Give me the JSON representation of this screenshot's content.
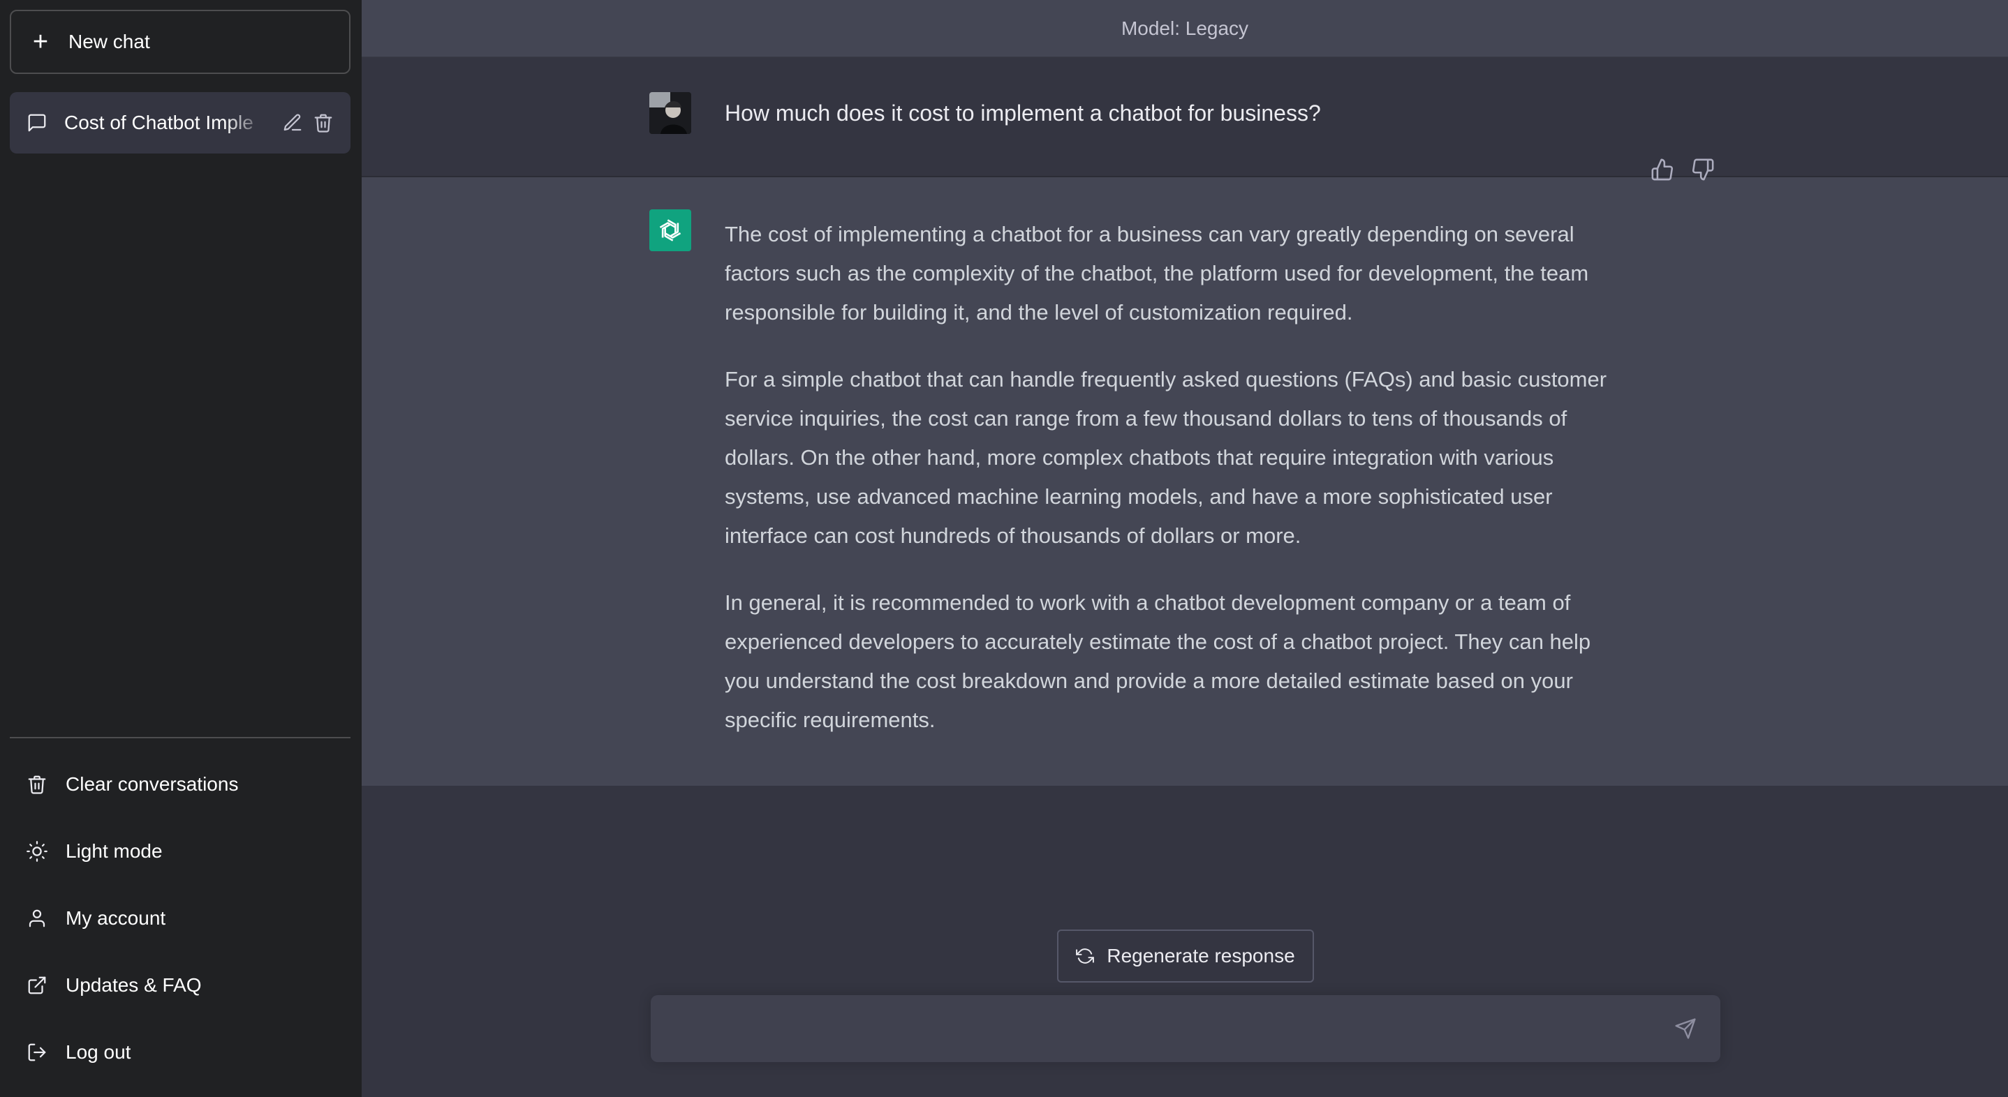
{
  "sidebar": {
    "new_chat_label": "New chat",
    "conversations": [
      {
        "title": "Cost of Chatbot Imple"
      }
    ],
    "menu": {
      "clear_label": "Clear conversations",
      "light_mode_label": "Light mode",
      "account_label": "My account",
      "updates_label": "Updates & FAQ",
      "logout_label": "Log out"
    }
  },
  "header": {
    "model_label": "Model: Legacy"
  },
  "messages": {
    "user_question": "How much does it cost to implement a chatbot for business?",
    "assistant_paragraphs": [
      "The cost of implementing a chatbot for a business can vary greatly depending on several factors such as the complexity of the chatbot, the platform used for development, the team responsible for building it, and the level of customization required.",
      "For a simple chatbot that can handle frequently asked questions (FAQs) and basic customer service inquiries, the cost can range from a few thousand dollars to tens of thousands of dollars. On the other hand, more complex chatbots that require integration with various systems, use advanced machine learning models, and have a more sophisticated user interface can cost hundreds of thousands of dollars or more.",
      "In general, it is recommended to work with a chatbot development company or a team of experienced developers to accurately estimate the cost of a chatbot project. They can help you understand the cost breakdown and provide a more detailed estimate based on your specific requirements."
    ]
  },
  "composer": {
    "regenerate_label": "Regenerate response",
    "input_value": "",
    "input_placeholder": ""
  },
  "colors": {
    "sidebar_bg": "#202123",
    "main_bg": "#343541",
    "assistant_bg": "#444654",
    "accent": "#10a37f"
  },
  "icons": {
    "new_chat": "plus-icon",
    "conversation": "message-icon",
    "edit": "pencil-icon",
    "delete": "trash-icon",
    "clear": "trash-icon",
    "light_mode": "sun-icon",
    "account": "user-icon",
    "updates": "external-link-icon",
    "logout": "logout-icon",
    "regenerate": "refresh-icon",
    "send": "paper-plane-icon",
    "thumbs_up": "thumbs-up-icon",
    "thumbs_down": "thumbs-down-icon"
  }
}
